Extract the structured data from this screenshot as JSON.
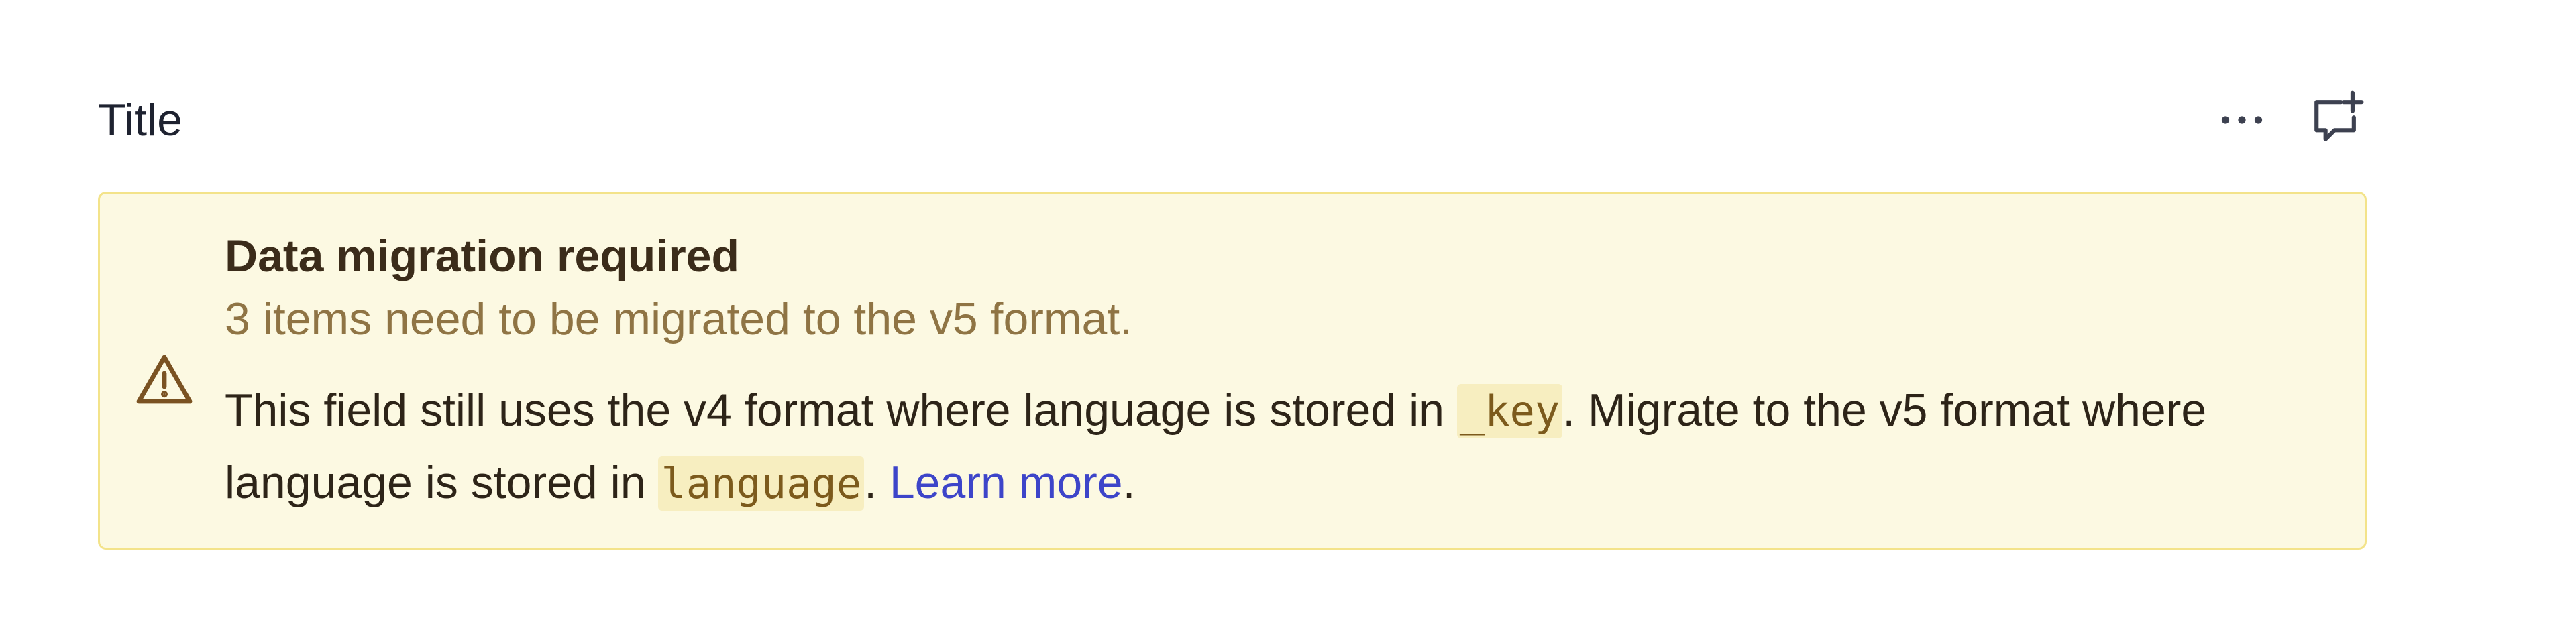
{
  "field": {
    "title": "Title",
    "actions": {
      "more_icon": "more-horizontal-icon",
      "comment_icon": "comment-add-icon"
    }
  },
  "callout": {
    "tone": "caution",
    "icon": "warning-triangle-icon",
    "title": "Data migration required",
    "subtitle": "3 items need to be migrated to the v5 format.",
    "text_part1": "This field still uses the v4 format where language is stored in ",
    "code1": "_key",
    "text_part2": ". Migrate to the v5 format where language is stored in ",
    "code2": "language",
    "text_part3": ". ",
    "link": "Learn more",
    "text_part4": ".",
    "colors": {
      "background": "#fcf9e2",
      "border": "#f3e38a",
      "link": "#3d45c9"
    }
  }
}
